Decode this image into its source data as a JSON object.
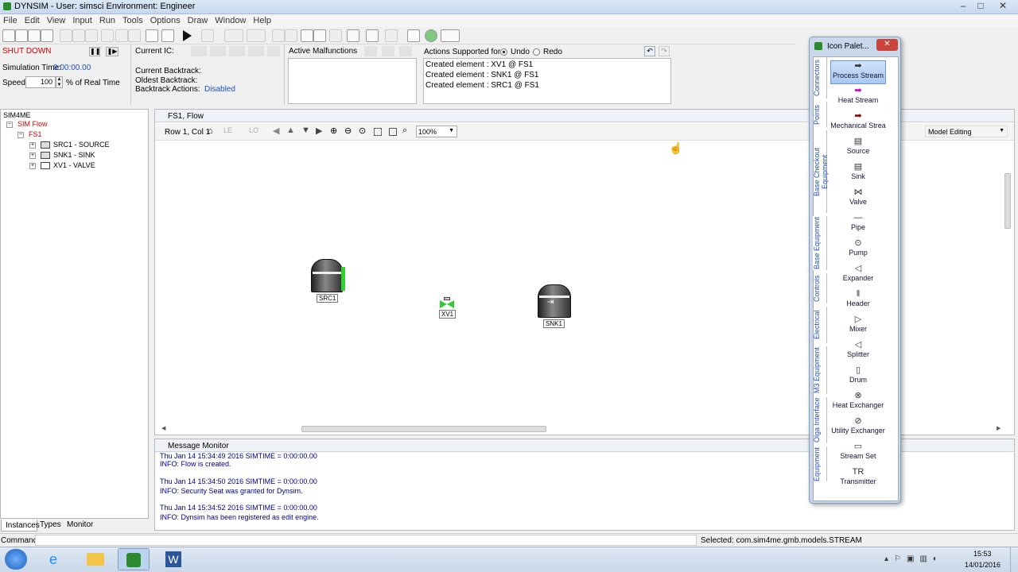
{
  "window": {
    "title": "DYNSIM - User: simsci    Environment: Engineer"
  },
  "menu": [
    "File",
    "Edit",
    "View",
    "Input",
    "Run",
    "Tools",
    "Options",
    "Draw",
    "Window",
    "Help"
  ],
  "sim_panel": {
    "state": "SHUT DOWN",
    "sim_time_label": "Simulation Time:",
    "sim_time_value": "0:00:00.00",
    "speed_label": "Speed:",
    "speed_value": "100",
    "speed_unit": "% of Real Time"
  },
  "ic_panel": {
    "current_ic": "Current IC:",
    "current_backtrack": "Current Backtrack:",
    "oldest_backtrack": "Oldest Backtrack:",
    "backtrack_actions_label": "Backtrack Actions:",
    "backtrack_actions_value": "Disabled"
  },
  "malfunctions": {
    "label": "Active Malfunctions"
  },
  "actions": {
    "label": "Actions Supported for :",
    "undo": "Undo",
    "redo": "Redo",
    "log": [
      "Created element : XV1 @ FS1",
      "Created element : SNK1 @ FS1",
      "Created element : SRC1 @ FS1"
    ]
  },
  "tree": {
    "root": "SIM4ME",
    "sim": "SIM Flow",
    "fs": "FS1",
    "items": [
      "SRC1 - SOURCE",
      "SNK1 - SINK",
      "XV1 - VALVE"
    ],
    "tabs": [
      "Instances",
      "Types",
      "Monitor"
    ]
  },
  "flowsheet": {
    "title": "FS1, Flow",
    "row_col": "Row 1, Col 1",
    "zoom": "100%",
    "mode": "Model Editing",
    "elements": [
      "SRC1",
      "XV1",
      "SNK1"
    ]
  },
  "palette": {
    "title": "Icon Palet...",
    "tabs": [
      "Connectors",
      "Points",
      "Base Checkout Equipment",
      "Base Equipment",
      "Controls",
      "Electrical",
      "M3 Equipment",
      "Olga Interface",
      "Equipment"
    ],
    "items": [
      {
        "label": "Process Stream",
        "icon": "process-stream-arrow",
        "color": "#333333"
      },
      {
        "label": "Heat Stream",
        "icon": "heat-stream-arrow",
        "color": "#cc00cc"
      },
      {
        "label": "Mechanical Strea",
        "icon": "mechanical-stream-arrow",
        "color": "#8b0000"
      },
      {
        "label": "Source",
        "icon": "source-icon",
        "color": "#333333"
      },
      {
        "label": "Sink",
        "icon": "sink-icon",
        "color": "#333333"
      },
      {
        "label": "Valve",
        "icon": "valve-icon",
        "color": "#333333"
      },
      {
        "label": "Pipe",
        "icon": "pipe-icon",
        "color": "#333333"
      },
      {
        "label": "Pump",
        "icon": "pump-icon",
        "color": "#333333"
      },
      {
        "label": "Expander",
        "icon": "expander-icon",
        "color": "#333333"
      },
      {
        "label": "Header",
        "icon": "header-icon",
        "color": "#333333"
      },
      {
        "label": "Mixer",
        "icon": "mixer-icon",
        "color": "#333333"
      },
      {
        "label": "Splitter",
        "icon": "splitter-icon",
        "color": "#333333"
      },
      {
        "label": "Drum",
        "icon": "drum-icon",
        "color": "#333333"
      },
      {
        "label": "Heat Exchanger",
        "icon": "heat-exchanger-icon",
        "color": "#333333"
      },
      {
        "label": "Utility Exchanger",
        "icon": "utility-exchanger-icon",
        "color": "#333333"
      },
      {
        "label": "Stream Set",
        "icon": "stream-set-icon",
        "color": "#333333"
      },
      {
        "label": "Transmitter",
        "icon": "transmitter-icon",
        "color": "#333333"
      }
    ]
  },
  "message_monitor": {
    "title": "Message Monitor",
    "lines": [
      "Thu Jan 14 15:34:49 2016  SIMTIME = 0:00:00.00",
      "INFO: Flow is created.",
      "",
      "Thu Jan 14 15:34:50 2016  SIMTIME = 0:00:00.00",
      "INFO: Security Seat was granted for Dynsim.",
      "",
      "Thu Jan 14 15:34:52 2016  SIMTIME = 0:00:00.00",
      "INFO: Dynsim has been registered as edit engine."
    ]
  },
  "status": {
    "command_label": "Command:",
    "selected": "Selected: com.sim4me.gmb.models.STREAM"
  },
  "taskbar": {
    "time": "15:53",
    "date": "14/01/2016"
  }
}
